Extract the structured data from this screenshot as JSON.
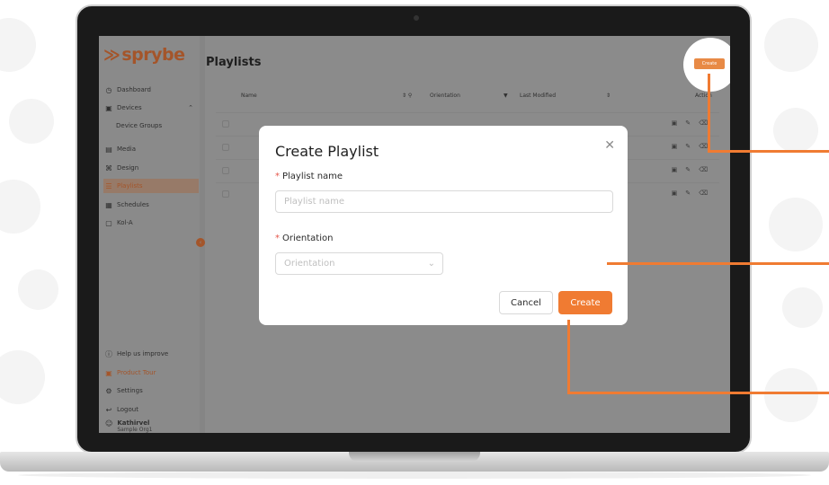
{
  "app": {
    "logo_text": "sprybe",
    "page_title": "Playlists",
    "create_button_label": "Create"
  },
  "sidebar": {
    "items": [
      {
        "label": "Dashboard",
        "icon": "clock-icon"
      },
      {
        "label": "Devices",
        "icon": "devices-icon"
      },
      {
        "label": "Device Groups",
        "icon": ""
      },
      {
        "label": "Media",
        "icon": "media-icon"
      },
      {
        "label": "Design",
        "icon": "design-icon"
      },
      {
        "label": "Playlists",
        "icon": "playlist-icon"
      },
      {
        "label": "Schedules",
        "icon": "schedule-icon"
      },
      {
        "label": "Kol-A",
        "icon": "screen-icon"
      }
    ],
    "bottom_items": [
      {
        "label": "Help us improve",
        "icon": "help-icon"
      },
      {
        "label": "Product Tour",
        "icon": "tour-icon"
      },
      {
        "label": "Settings",
        "icon": "gear-icon"
      },
      {
        "label": "Logout",
        "icon": "logout-icon"
      }
    ],
    "user": {
      "name": "Kathirvel",
      "org": "Sample Org1"
    }
  },
  "table": {
    "columns": [
      "Name",
      "Orientation",
      "Last Modified",
      "Action"
    ]
  },
  "modal": {
    "title": "Create Playlist",
    "name_label": "Playlist name",
    "name_placeholder": "Playlist name",
    "orientation_label": "Orientation",
    "orientation_placeholder": "Orientation",
    "cancel_label": "Cancel",
    "create_label": "Create"
  },
  "colors": {
    "accent": "#f07b32",
    "required": "#e5564a"
  }
}
